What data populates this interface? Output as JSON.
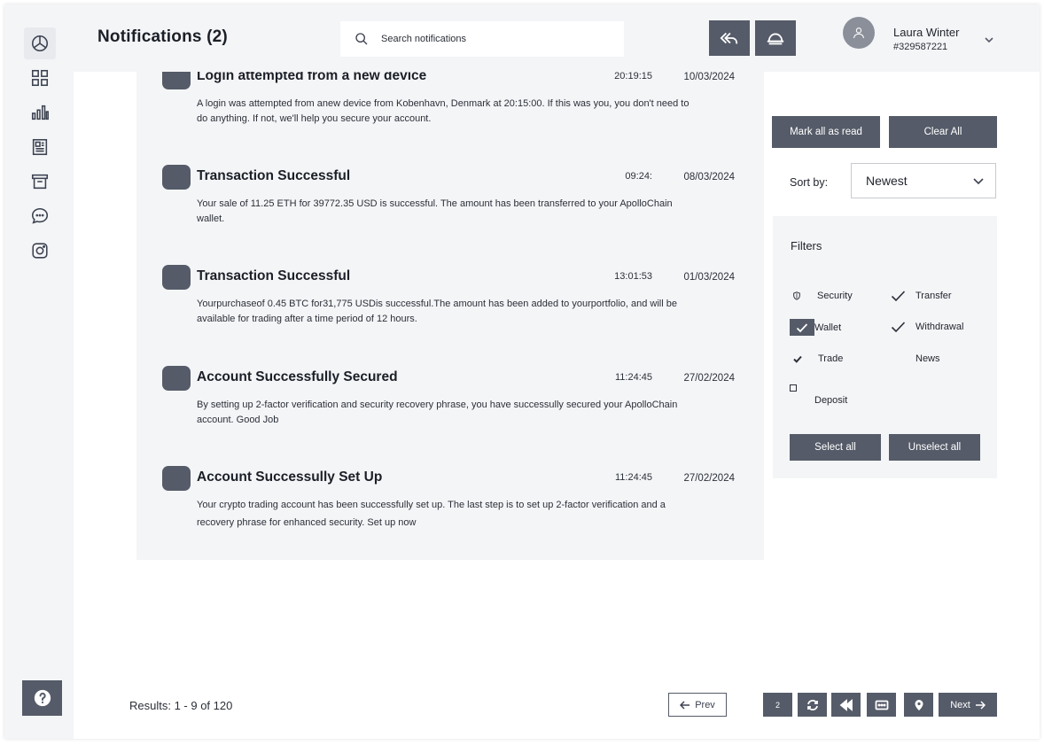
{
  "sidebar": {
    "items": [
      {
        "icon": "pie-chart-icon"
      },
      {
        "icon": "grid-icon"
      },
      {
        "icon": "bar-chart-icon"
      },
      {
        "icon": "news-icon"
      },
      {
        "icon": "archive-icon"
      },
      {
        "icon": "chat-icon"
      },
      {
        "icon": "instagram-icon"
      }
    ],
    "help_icon": "question-icon"
  },
  "header": {
    "title": "Notifications (2)",
    "search_placeholder": "Search notifications",
    "user": {
      "name": "Laura Winter",
      "id": "#329587221"
    }
  },
  "notifications": [
    {
      "title": "Login attempted from a new device",
      "time": "20:19:15",
      "date": "10/03/2024",
      "body": "A login was attempted from anew device from Kobenhavn, Denmark at 20:15:00. If this was you, you don't need to do anything. If not, we'll help you secure your account."
    },
    {
      "title": "Transaction Successful",
      "time": "09:24:",
      "date": "08/03/2024",
      "body": "Your sale of 11.25 ETH for 39772.35 USD is successful. The amount has been transferred to your ApolloChain wallet."
    },
    {
      "title": "Transaction Successful",
      "time": "13:01:53",
      "date": "01/03/2024",
      "body": "Yourpurchaseof 0.45 BTC for31,775 USDis successful.The amount has been added to yourportfolio, and will be available for trading after a time period of 12 hours."
    },
    {
      "title": "Account Successfully Secured",
      "time": "11:24:45",
      "date": "27/02/2024",
      "body": "By setting up 2-factor verification and security recovery phrase, you have successully secured your ApolloChain account. Good Job"
    },
    {
      "title": "Account Successully Set Up",
      "time": "11:24:45",
      "date": "27/02/2024",
      "body": "Your crypto trading account has been successfully set up. The last step is to set up 2-factor verification and a recovery phrase for enhanced security. Set up now"
    }
  ],
  "actions": {
    "mark_all_read": "Mark all as read",
    "clear_all": "Clear All"
  },
  "sort": {
    "label": "Sort by:",
    "value": "Newest"
  },
  "filters": {
    "title": "Filters",
    "items": [
      {
        "label": "Security",
        "state": "shield"
      },
      {
        "label": "Transfer",
        "state": "checked"
      },
      {
        "label": "Wallet",
        "state": "checked-box"
      },
      {
        "label": "Withdrawal",
        "state": "checked"
      },
      {
        "label": "Trade",
        "state": "checked-small"
      },
      {
        "label": "News",
        "state": "none"
      },
      {
        "label": "Deposit",
        "state": "unchecked"
      }
    ],
    "select_all": "Select all",
    "unselect_all": "Unselect all"
  },
  "pagination": {
    "results": "Results: 1 - 9 of 120",
    "prev": "Prev",
    "next": "Next",
    "page": "2"
  },
  "colors": {
    "accent": "#555b68",
    "panel": "#f4f5f7"
  }
}
